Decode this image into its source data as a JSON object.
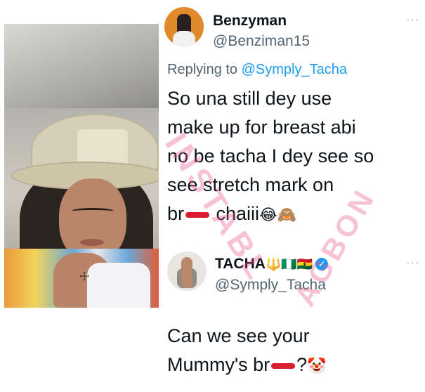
{
  "tweet1": {
    "name": "Benzyman",
    "handle": "@Benziman15",
    "more": "···",
    "reply_prefix": "Replying to ",
    "reply_to": "@Symply_Tacha",
    "lines": [
      "So una still dey use",
      "make up for breast abi",
      "no be tacha I dey see so",
      "see stretch mark on"
    ],
    "last_prefix": "br",
    "last_suffix": " chaiii",
    "emojis": "😂🙈"
  },
  "tweet2": {
    "name": "TACHA",
    "flags": "🔱🇳🇬🇬🇭",
    "verified": "✓",
    "handle": "@Symply_Tacha",
    "more": "···",
    "line1": "Can we see your",
    "line2_prefix": "Mummy's br",
    "line2_suffix": "?",
    "emoji": "🤡"
  },
  "watermark": {
    "text1": "INSTABL",
    "text2": "AGBON"
  },
  "colors": {
    "handle": "#536471",
    "link": "#1d9bf0",
    "redaction": "#d61e2e",
    "watermark": "#e7508a"
  }
}
